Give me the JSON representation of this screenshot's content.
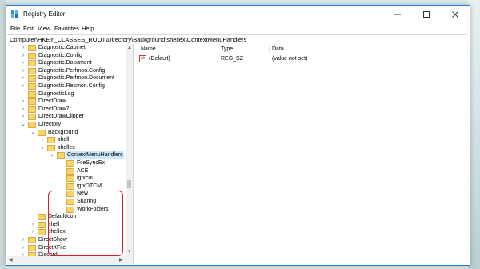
{
  "window": {
    "title": "Registry Editor"
  },
  "menu": [
    "File",
    "Edit",
    "View",
    "Favorites",
    "Help"
  ],
  "address": "Computer\\HKEY_CLASSES_ROOT\\Directory\\Background\\shellex\\ContextMenuHandlers",
  "tree": {
    "items": [
      {
        "label": "Diagnostic.Cabinet",
        "expander": ">"
      },
      {
        "label": "Diagnostic.Config",
        "expander": ">"
      },
      {
        "label": "Diagnostic.Document",
        "expander": ">"
      },
      {
        "label": "Diagnostic.Perfmon.Config",
        "expander": ">"
      },
      {
        "label": "Diagnostic.Perfmon.Document",
        "expander": ">"
      },
      {
        "label": "Diagnostic.Resmon.Config",
        "expander": ">"
      },
      {
        "label": "DiagnosticLog",
        "expander": ""
      },
      {
        "label": "DirectDraw",
        "expander": ">"
      },
      {
        "label": "DirectDraw7",
        "expander": ">"
      },
      {
        "label": "DirectDrawClipper",
        "expander": ">"
      },
      {
        "label": "Directory",
        "expander": "v"
      },
      {
        "label": "Background",
        "expander": "v"
      },
      {
        "label": "shell",
        "expander": ">"
      },
      {
        "label": "shellex",
        "expander": "v"
      },
      {
        "label": "ContextMenuHandlers",
        "expander": "v"
      },
      {
        "label": "FileSyncEx",
        "expander": ""
      },
      {
        "label": "ACE",
        "expander": ""
      },
      {
        "label": "igfxcui",
        "expander": ""
      },
      {
        "label": "igfxDTCM",
        "expander": ""
      },
      {
        "label": "New",
        "expander": ""
      },
      {
        "label": "Sharing",
        "expander": ""
      },
      {
        "label": "WorkFolders",
        "expander": ""
      },
      {
        "label": "DefaultIcon",
        "expander": ""
      },
      {
        "label": "shell",
        "expander": ">"
      },
      {
        "label": "shellex",
        "expander": ">"
      },
      {
        "label": "DirectShow",
        "expander": ">"
      },
      {
        "label": "DirectXFile",
        "expander": ">"
      },
      {
        "label": "Discord",
        "expander": ">"
      }
    ]
  },
  "list": {
    "headers": {
      "name": "Name",
      "type": "Type",
      "data": "Data"
    },
    "rows": [
      {
        "icon": "ab",
        "name": "(Default)",
        "type": "REG_SZ",
        "data": "(value not set)"
      }
    ]
  },
  "colors": {
    "highlight": "#e0192d",
    "selection": "#cce8ff",
    "folder": "#f7d46b"
  }
}
